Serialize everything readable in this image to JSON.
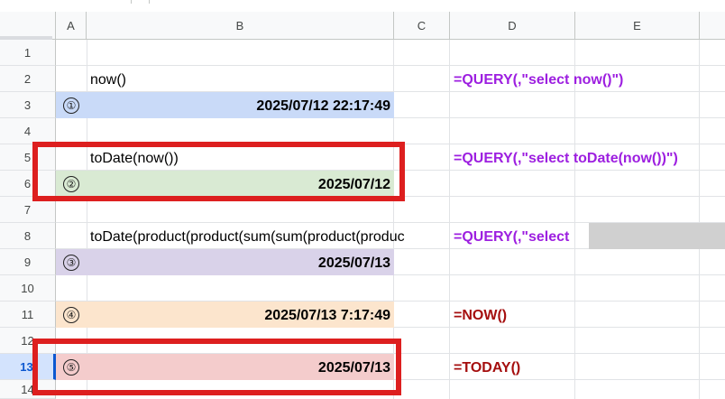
{
  "columns": [
    "A",
    "B",
    "C",
    "D",
    "E"
  ],
  "rows": [
    "1",
    "2",
    "3",
    "4",
    "5",
    "6",
    "7",
    "8",
    "9",
    "10",
    "11",
    "12",
    "13",
    "14"
  ],
  "selected_row": "13",
  "cells": {
    "b2": "now()",
    "d2": "=QUERY(,\"select now()\")",
    "a3": "①",
    "b3": "2025/07/12 22:17:49",
    "b5": "toDate(now())",
    "d5": "=QUERY(,\"select toDate(now())\")",
    "a6": "②",
    "b6": "2025/07/12",
    "b8": "toDate(product(product(sum(sum(product(produc",
    "d8": "=QUERY(,\"select",
    "a9": "③",
    "b9": "2025/07/13",
    "a11": "④",
    "b11": "2025/07/13 7:17:49",
    "d11": "=NOW()",
    "a13": "⑤",
    "b13": "2025/07/13",
    "d13": "=TODAY()"
  },
  "colors": {
    "formula_purple": "#9d1fe0",
    "formula_red": "#a50e0e",
    "highlight_red": "#dd1f1f",
    "fill_blue": "#c9daf8",
    "fill_green": "#d9ead3",
    "fill_purple": "#d9d2e9",
    "fill_orange": "#fce5cd",
    "fill_pink": "#f4cccc"
  }
}
